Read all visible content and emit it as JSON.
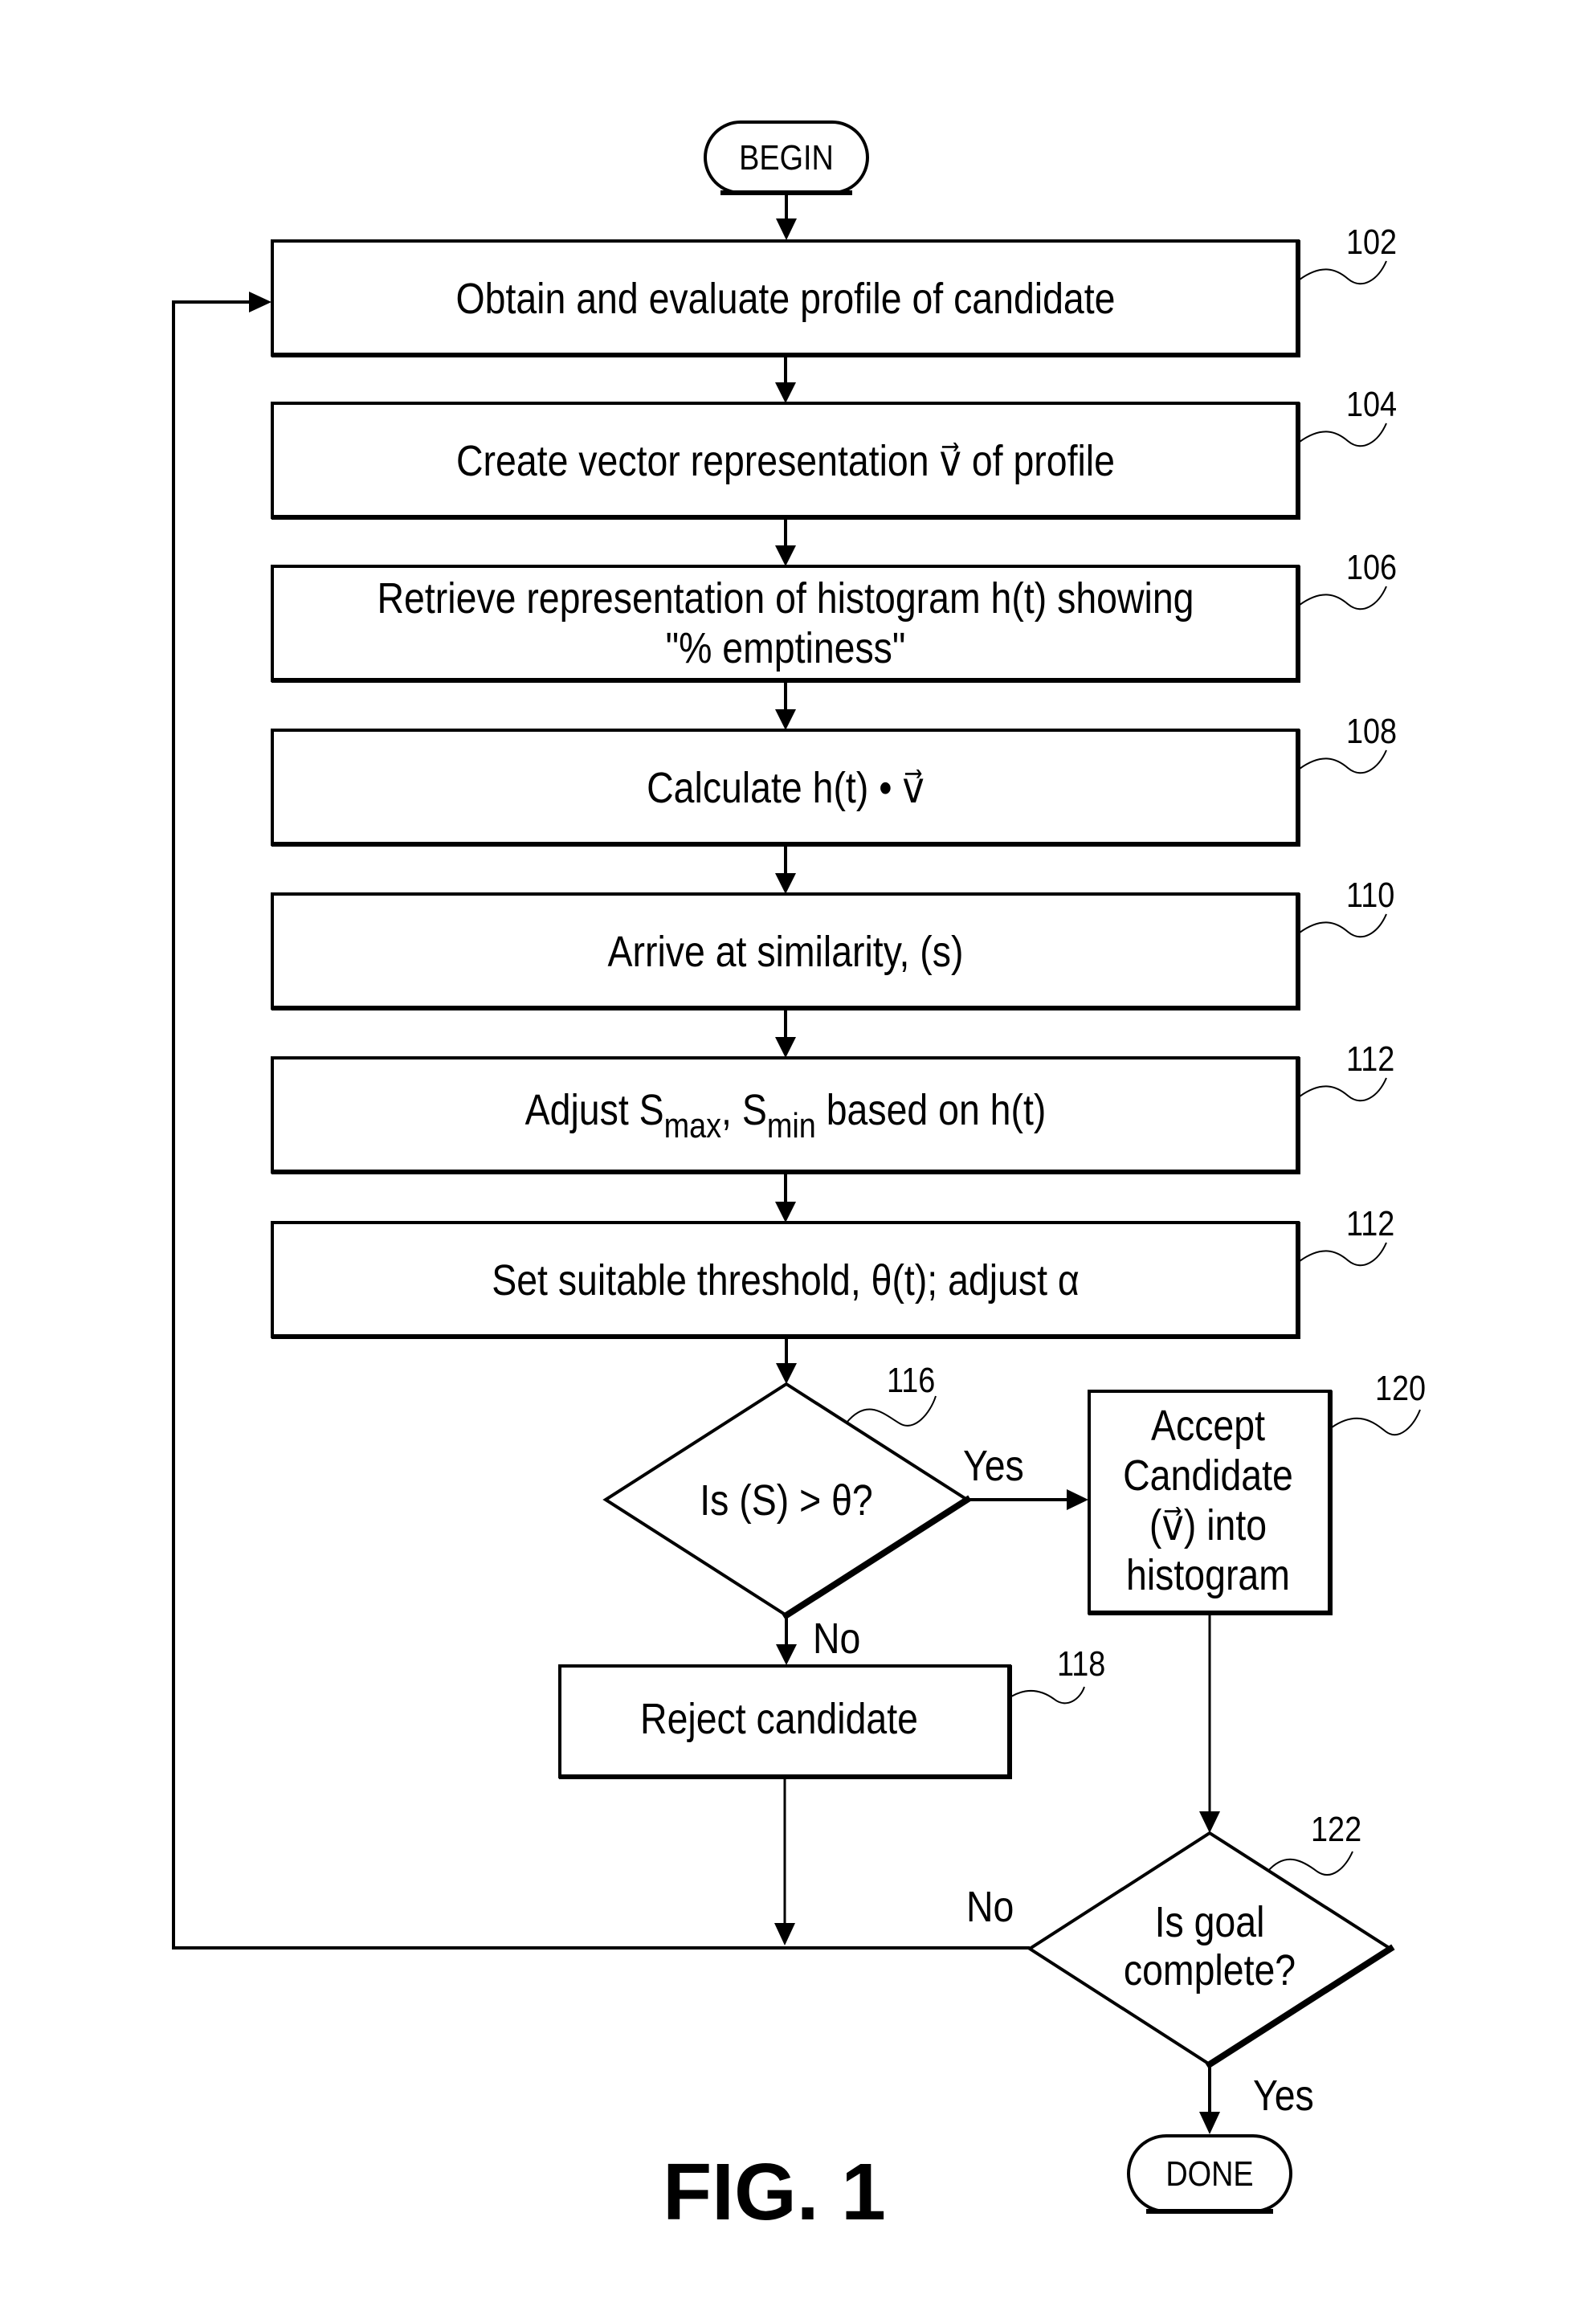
{
  "figure": {
    "caption": "FIG. 1",
    "terminals": {
      "begin": "BEGIN",
      "done": "DONE"
    },
    "steps": [
      {
        "ref": "102",
        "lines": [
          "Obtain and evaluate profile of candidate"
        ]
      },
      {
        "ref": "104",
        "lines": [
          "Create vector representation v⃗ of profile"
        ]
      },
      {
        "ref": "106",
        "lines": [
          "Retrieve representation of histogram h(t) showing",
          "\"% emptiness\""
        ]
      },
      {
        "ref": "108",
        "lines": [
          "Calculate h(t) • v⃗"
        ]
      },
      {
        "ref": "110",
        "lines": [
          "Arrive at similarity, (s)"
        ]
      },
      {
        "ref": "112",
        "parts": {
          "pre": "Adjust S",
          "sub1": "max",
          "mid": ", S",
          "sub2": "min",
          "post": " based on h(t)"
        }
      },
      {
        "ref": "112",
        "lines": [
          "Set suitable threshold, θ(t); adjust α"
        ]
      }
    ],
    "decisions": [
      {
        "ref": "116",
        "lines": [
          "Is (S) > θ?"
        ],
        "yes_label": "Yes",
        "no_label": "No"
      },
      {
        "ref": "122",
        "lines": [
          "Is goal",
          "complete?"
        ],
        "yes_label": "Yes",
        "no_label": "No"
      }
    ],
    "accept_box": {
      "ref": "120",
      "lines": [
        "Accept",
        "Candidate",
        "(v⃗) into",
        "histogram"
      ]
    },
    "reject_box": {
      "ref": "118",
      "lines": [
        "Reject candidate"
      ]
    }
  }
}
